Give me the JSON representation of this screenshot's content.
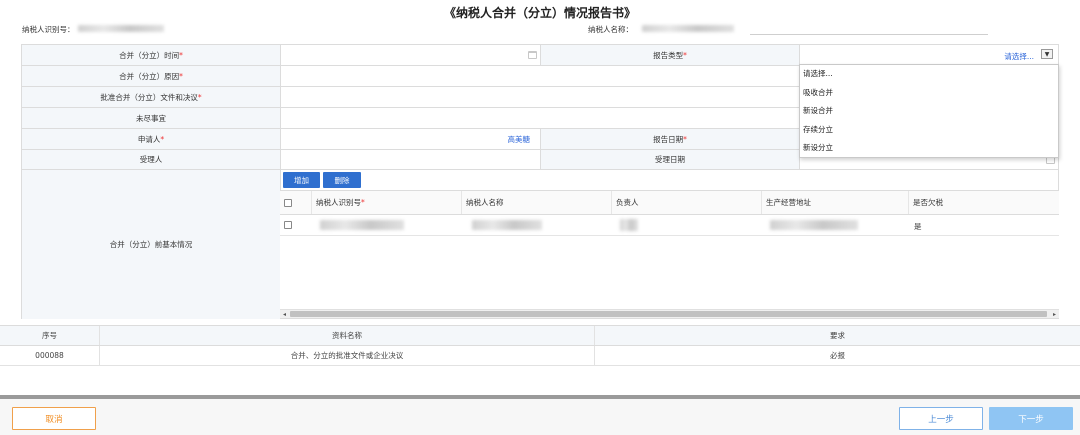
{
  "title": "《纳税人合并（分立）情况报告书》",
  "header": {
    "taxpayer_id_label": "纳税人识别号：",
    "taxpayer_name_label": "纳税人名称："
  },
  "form": {
    "merge_time_label": "合并（分立）时间",
    "report_type_label": "报告类型",
    "report_type_value": "请选择...",
    "merge_reason_label": "合并（分立）原因",
    "approval_doc_label": "批准合并（分立）文件和决议",
    "pending_matters_label": "未尽事宜",
    "applicant_label": "申请人",
    "applicant_value": "高美糖",
    "report_date_label": "报告日期",
    "acceptor_label": "受理人",
    "accept_date_label": "受理日期",
    "basic_info_label": "合并（分立）前基本情况",
    "required_mark": "*"
  },
  "report_type_options": [
    "请选择...",
    "吸收合并",
    "新设合并",
    "存续分立",
    "新设分立"
  ],
  "sub_table": {
    "add_button": "增加",
    "delete_button": "删除",
    "columns": [
      "纳税人识别号",
      "纳税人名称",
      "负责人",
      "生产经营地址",
      "是否欠税"
    ],
    "rows": [
      {
        "owes_tax": "是"
      }
    ]
  },
  "docs_table": {
    "columns": [
      "序号",
      "资料名称",
      "要求"
    ],
    "rows": [
      {
        "no": "000088",
        "name": "合并、分立的批准文件或企业决议",
        "requirement": "必报"
      }
    ]
  },
  "footer": {
    "cancel": "取消",
    "prev": "上一步",
    "next": "下一步"
  }
}
